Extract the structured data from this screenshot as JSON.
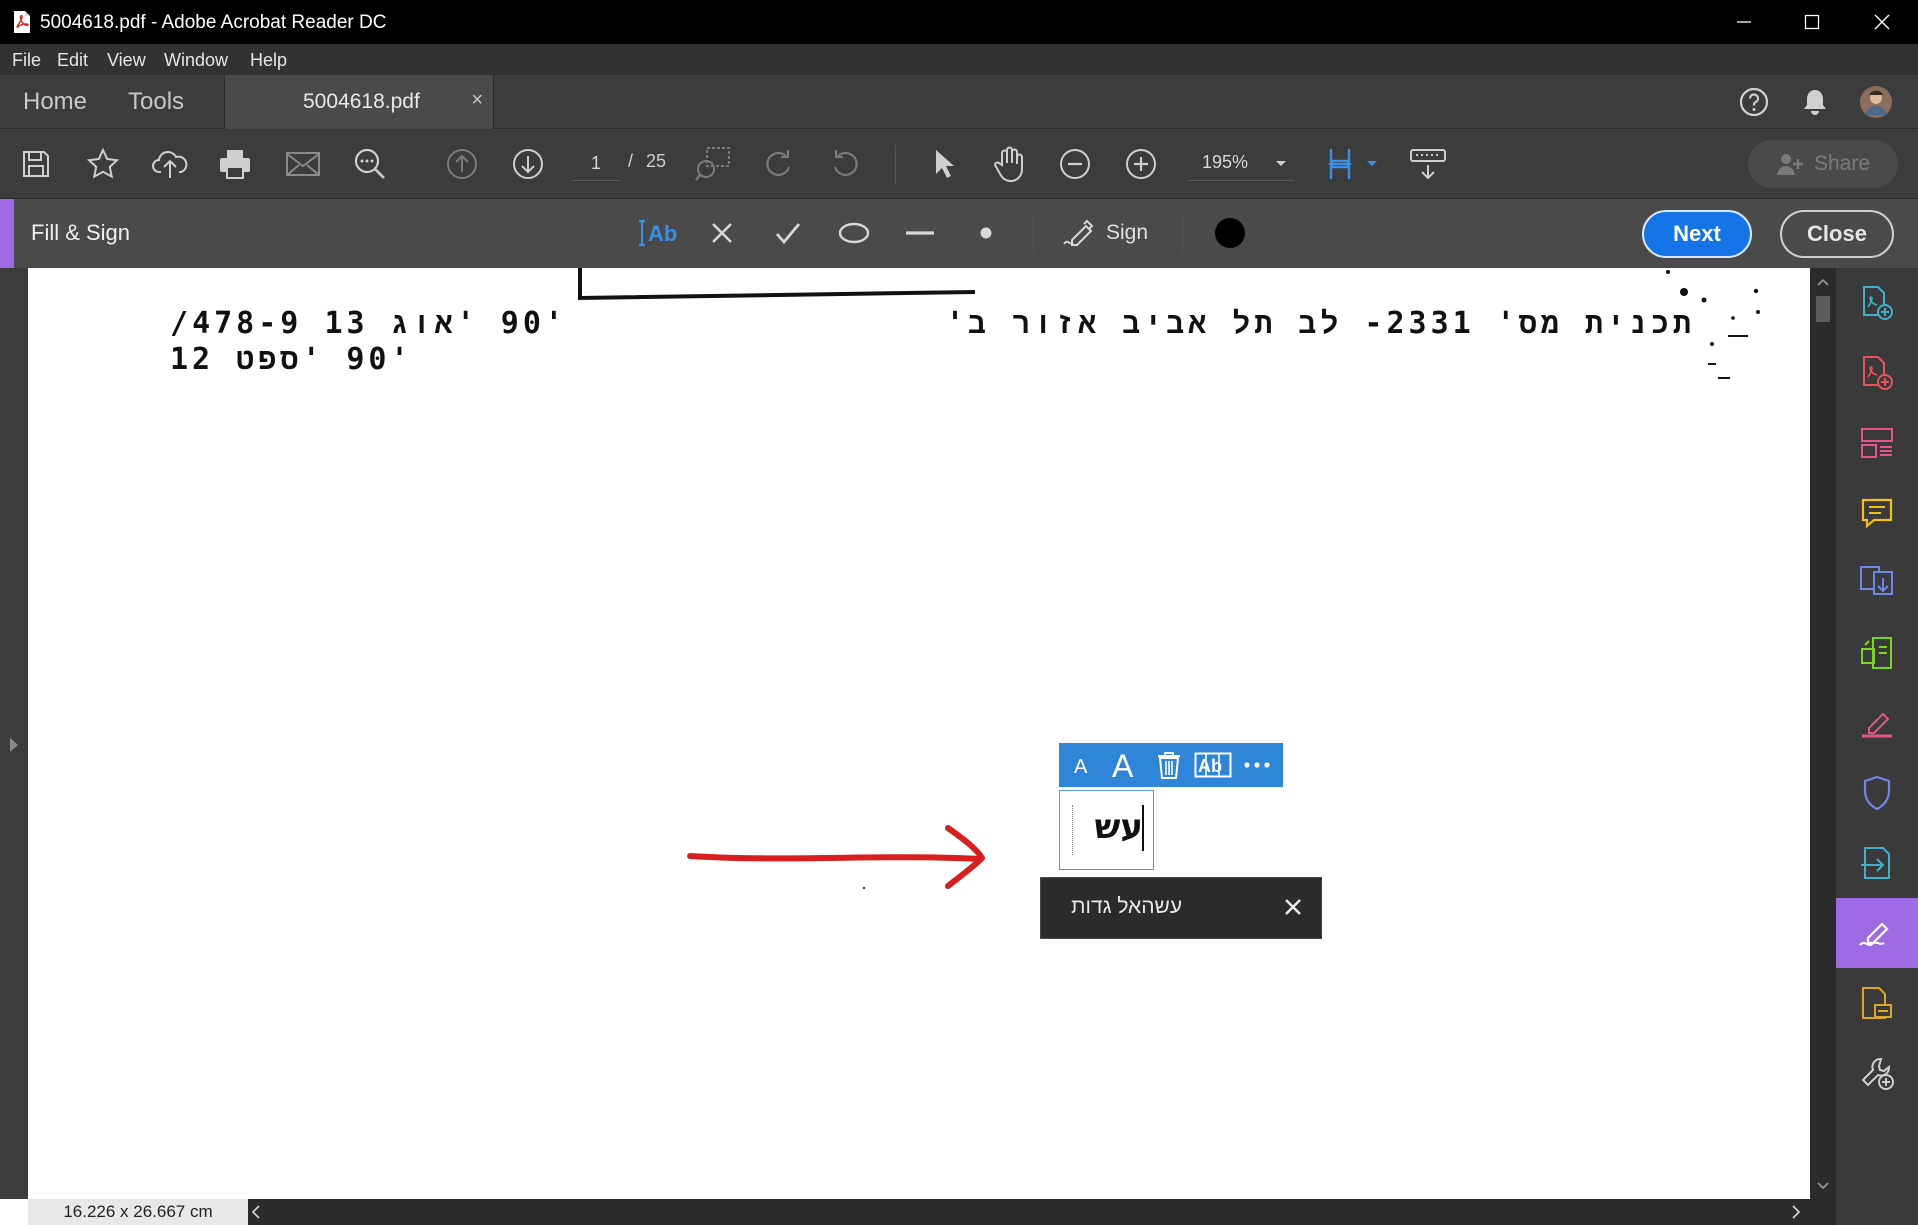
{
  "window": {
    "title": "5004618.pdf - Adobe Acrobat Reader DC"
  },
  "menu": [
    "File",
    "Edit",
    "View",
    "Window",
    "Help"
  ],
  "tabs": {
    "home": "Home",
    "tools": "Tools",
    "document": "5004618.pdf",
    "close_glyph": "×"
  },
  "toolbar": {
    "page_current": "1",
    "page_separator": "/",
    "page_total": "25",
    "zoom": "195%",
    "share_label": "Share"
  },
  "fill_sign": {
    "title": "Fill & Sign",
    "sign_label": "Sign",
    "next_label": "Next",
    "close_label": "Close",
    "accent_color": "#9e6be4",
    "primary_color": "#1473e6"
  },
  "document": {
    "line1_right": "תכנית מס' 2331- לב תל אביב אזור ב'",
    "line1_left": "'90 'אוג 13 478-9/",
    "line2_left": "'90 'ספט 12",
    "field_value": "עש",
    "suggestion_text": "עשהאל גדות"
  },
  "status": {
    "page_size": "16.226 x 26.667 cm"
  }
}
